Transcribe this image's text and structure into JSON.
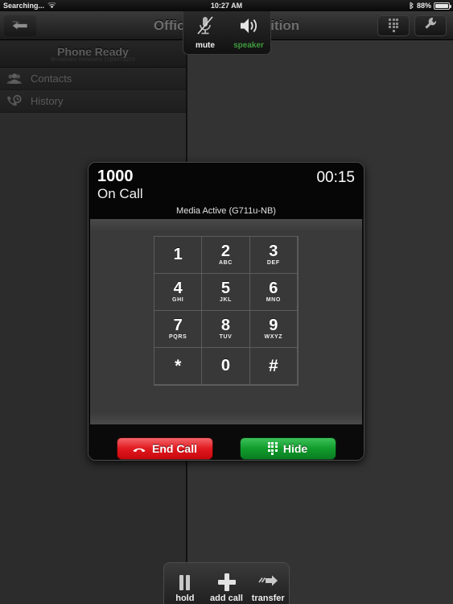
{
  "statusbar": {
    "carrier": "Searching...",
    "wifi_icon": "wifi-icon",
    "time": "10:27 AM",
    "bluetooth_icon": "bluetooth-icon",
    "battery_percent": "88%",
    "battery_icon": "battery-icon"
  },
  "navbar": {
    "back_label": "back-arrow-icon",
    "title": "OfficeSuite HD Edition",
    "keypad_button": "keypad-icon",
    "settings_button": "wrench-icon"
  },
  "sidebar": {
    "status_title": "Phone Ready",
    "status_sub": "Broadview Networks 7189479209",
    "items": [
      {
        "label": "Contacts",
        "icon": "contacts-icon"
      },
      {
        "label": "History",
        "icon": "history-icon"
      }
    ]
  },
  "audio_overlay": {
    "mute": {
      "label": "mute",
      "icon": "microphone-muted-icon",
      "active": false
    },
    "speaker": {
      "label": "speaker",
      "icon": "speaker-icon",
      "active": true
    },
    "active_color": "#3f9b3f"
  },
  "call": {
    "number": "1000",
    "state": "On Call",
    "timer": "00:15",
    "media_status": "Media Active (G711u-NB)",
    "end_call_label": "End Call",
    "end_call_color": "#e01a20",
    "hide_label": "Hide",
    "hide_color": "#119c2c",
    "keypad": [
      {
        "digit": "1",
        "letters": ""
      },
      {
        "digit": "2",
        "letters": "ABC"
      },
      {
        "digit": "3",
        "letters": "DEF"
      },
      {
        "digit": "4",
        "letters": "GHI"
      },
      {
        "digit": "5",
        "letters": "JKL"
      },
      {
        "digit": "6",
        "letters": "MNO"
      },
      {
        "digit": "7",
        "letters": "PQRS"
      },
      {
        "digit": "8",
        "letters": "TUV"
      },
      {
        "digit": "9",
        "letters": "WXYZ"
      },
      {
        "digit": "*",
        "letters": ""
      },
      {
        "digit": "0",
        "letters": ""
      },
      {
        "digit": "#",
        "letters": ""
      }
    ]
  },
  "bottom_toolbar": {
    "items": [
      {
        "label": "hold",
        "icon": "pause-icon"
      },
      {
        "label": "add call",
        "icon": "plus-icon"
      },
      {
        "label": "transfer",
        "icon": "transfer-arrow-icon"
      }
    ]
  }
}
